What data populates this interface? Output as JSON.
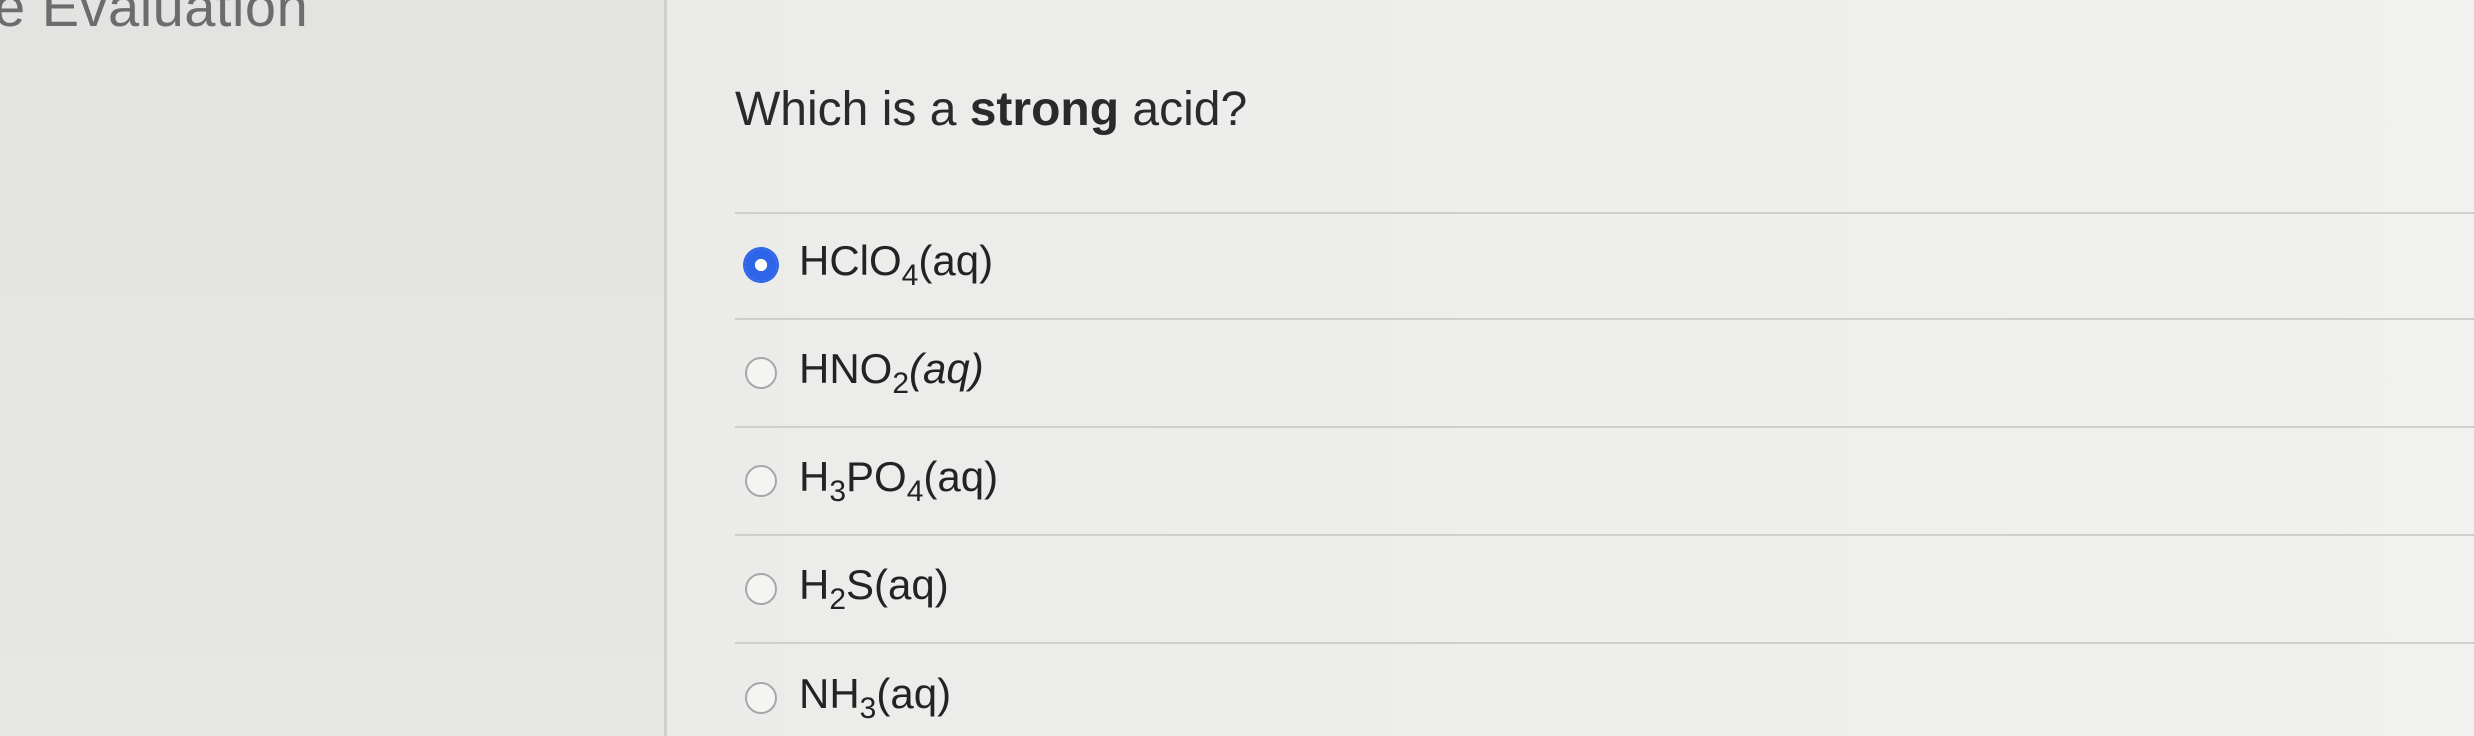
{
  "header": {
    "section_title": "e Evaluation"
  },
  "question": {
    "prefix": "Which is a ",
    "emphasis": "strong",
    "suffix": " acid?"
  },
  "options": [
    {
      "id": "hclo4",
      "parts": [
        "HClO",
        "4",
        "(aq)"
      ],
      "selected": true
    },
    {
      "id": "hno2",
      "parts": [
        "HNO",
        "2",
        "(aq)"
      ],
      "selected": false
    },
    {
      "id": "h3po4",
      "parts": [
        "H",
        "3",
        "PO",
        "4",
        "(aq)"
      ],
      "selected": false
    },
    {
      "id": "h2s",
      "parts": [
        "H",
        "2",
        "S(aq)"
      ],
      "selected": false
    },
    {
      "id": "nh3",
      "parts": [
        "NH",
        "3",
        "(aq)"
      ],
      "selected": false
    }
  ],
  "colors": {
    "accent": "#2e64e8",
    "text": "#232323",
    "muted_text": "#6c6c6c",
    "divider": "#cfcfcc"
  }
}
